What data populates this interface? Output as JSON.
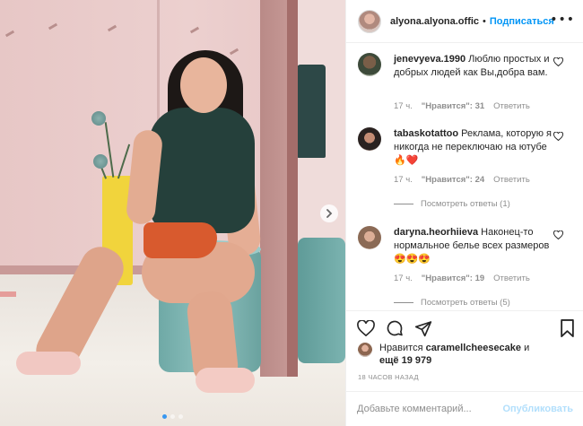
{
  "post": {
    "username": "alyona.alyona.offic",
    "separator": "•",
    "follow_label": "Подписаться",
    "more_label": "•••"
  },
  "photo": {
    "next_icon": "chevron-right-icon",
    "carousel_pages": 3,
    "carousel_active": 1
  },
  "comments": [
    {
      "username": "jenevyeva.1990",
      "text": "Люблю простых и добрых людей как Вы,добра вам.",
      "time": "17 ч.",
      "likes": "\"Нравится\": 31",
      "reply": "Ответить",
      "view_replies": ""
    },
    {
      "username": "tabaskotattoo",
      "text": "Реклама, которую я никогда не переключаю на ютубе🔥❤️",
      "time": "17 ч.",
      "likes": "\"Нравится\": 24",
      "reply": "Ответить",
      "view_replies": "Посмотреть ответы (1)"
    },
    {
      "username": "daryna.heorhiieva",
      "text": "Наконец-то нормальное белье всех размеров😍😍😍",
      "time": "17 ч.",
      "likes": "\"Нравится\": 19",
      "reply": "Ответить",
      "view_replies": "Посмотреть ответы (5)"
    }
  ],
  "likes": {
    "prefix": "Нравится",
    "user": "caramellcheesecake",
    "suffix": "и",
    "more": "ещё 19 979"
  },
  "time_ago": "18 ЧАСОВ НАЗАД",
  "add_comment": {
    "placeholder": "Добавьте комментарий...",
    "publish_label": "Опубликовать"
  },
  "colors": {
    "accent": "#0095f6",
    "publish_disabled": "#b2dffc",
    "muted": "#8e8e8e",
    "text": "#262626",
    "border": "#efefef"
  },
  "icons": {
    "like": "heart-icon",
    "comment": "comment-icon",
    "share": "paper-plane-icon",
    "save": "bookmark-icon",
    "comment_like": "small-heart-icon"
  }
}
